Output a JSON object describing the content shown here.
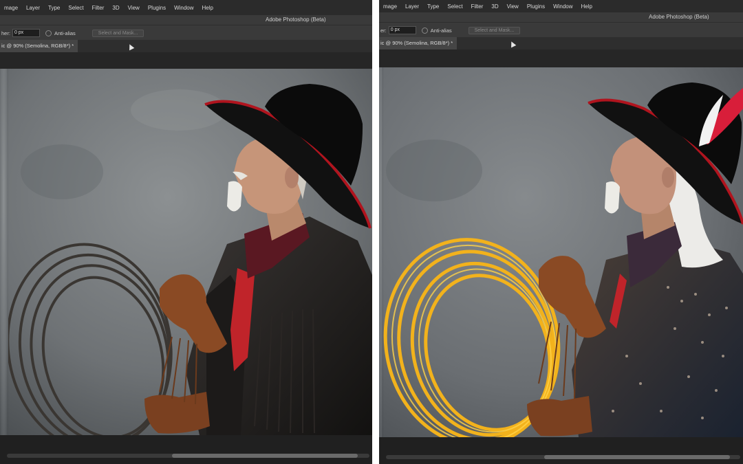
{
  "left": {
    "menu": [
      "mage",
      "Layer",
      "Type",
      "Select",
      "Filter",
      "3D",
      "View",
      "Plugins",
      "Window",
      "Help"
    ],
    "app_title": "Adobe Photoshop (Beta)",
    "options": {
      "field_label": "her:",
      "field_value": "0 px",
      "antialias": "Anti-alias",
      "select_mask": "Select and Mask..."
    },
    "doc_tab": "ic @ 90% (Semolina, RGB/8*) *"
  },
  "right": {
    "menu": [
      "mage",
      "Layer",
      "Type",
      "Select",
      "Filter",
      "3D",
      "View",
      "Plugins",
      "Window",
      "Help"
    ],
    "app_title": "Adobe Photoshop (Beta)",
    "options": {
      "field_label": "er:",
      "field_value": "0 px",
      "antialias": "Anti-alias",
      "select_mask": "Select and Mask..."
    },
    "doc_tab": "ic @ 90% (Semolina, RGB/8*) *"
  },
  "colors": {
    "rope_left": "#3a3632",
    "rope_right": "#f2b21c",
    "hat_brim": "#b0141e",
    "background": "#7c8083"
  }
}
